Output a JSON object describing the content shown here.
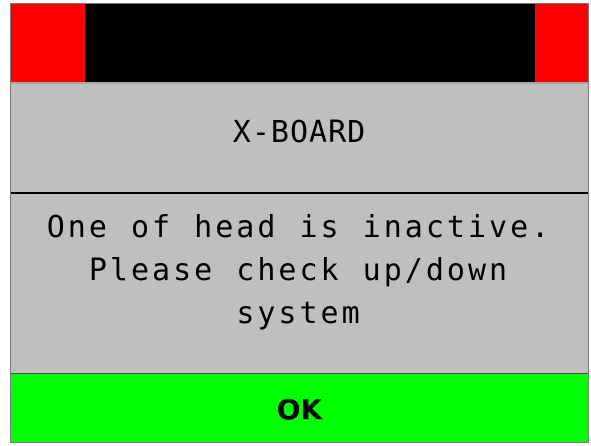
{
  "dialog": {
    "title": "X-BOARD",
    "message_lines": [
      "One of head is inactive.",
      "Please check up/down",
      "system"
    ],
    "ok_label": "OK"
  },
  "colors": {
    "titlebar_side": "#ff0000",
    "titlebar_center": "#000000",
    "dialog_background": "#bfbfbf",
    "ok_button": "#00ff00"
  }
}
